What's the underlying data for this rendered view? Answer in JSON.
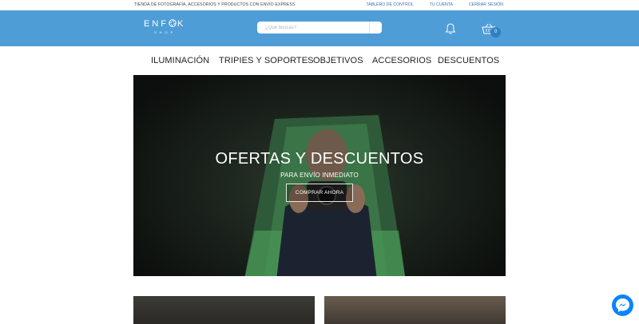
{
  "topbar": {
    "tagline": "TIENDA DE FOTOGRAFÍA, ACCESORIOS Y PRODUCTOS CON ENVÍO EXPRESS",
    "links": [
      "TABLERO DE CONTROL",
      "TU CUENTA",
      "CERRAR SESIÓN"
    ]
  },
  "header": {
    "logo_word": "ENF",
    "logo_word_end": "K",
    "logo_sub": "SHOP",
    "search_placeholder": "¿Qué buscas?",
    "cart_count": "0"
  },
  "nav": {
    "items": [
      "ILUMINACIÓN",
      "TRIPIES Y SOPORTES",
      "OBJETIVOS",
      "ACCESORIOS",
      "DESCUENTOS"
    ]
  },
  "hero": {
    "title": "OFERTAS Y DESCUENTOS",
    "subtitle": "PARA ENVÍO INMEDIATO",
    "cta_label": "COMPRAR AHORA"
  },
  "colors": {
    "header": "#4f9dd6",
    "badge": "#2f7fc3",
    "messenger": "#0b84ff"
  }
}
